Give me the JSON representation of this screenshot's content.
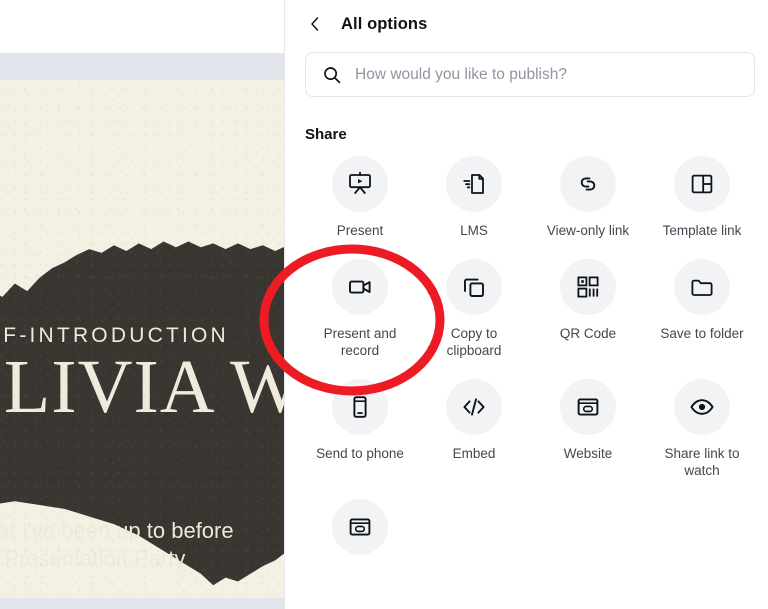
{
  "editor": {
    "slide": {
      "kicker": "SELF-INTRODUCTION",
      "name": "OLIVIA WILSON",
      "subtitle_line1": "What I've been up to before",
      "subtitle_line2": "this Presentation Party",
      "paper_color": "#f4f0e4",
      "ink_color": "#393530"
    }
  },
  "panel": {
    "back_icon": "chevron-left-icon",
    "title": "All options",
    "search": {
      "icon": "search-icon",
      "placeholder": "How would you like to publish?",
      "value": ""
    },
    "section_title": "Share",
    "options": [
      {
        "icon": "present-icon",
        "label": "Present"
      },
      {
        "icon": "lms-document-icon",
        "label": "LMS"
      },
      {
        "icon": "link-icon",
        "label": "View-only link"
      },
      {
        "icon": "template-layout-icon",
        "label": "Template link"
      },
      {
        "icon": "video-camera-icon",
        "label": "Present and record"
      },
      {
        "icon": "copy-icon",
        "label": "Copy to clipboard"
      },
      {
        "icon": "qr-code-icon",
        "label": "QR Code"
      },
      {
        "icon": "folder-icon",
        "label": "Save to folder"
      },
      {
        "icon": "mobile-phone-icon",
        "label": "Send to phone"
      },
      {
        "icon": "code-brackets-icon",
        "label": "Embed"
      },
      {
        "icon": "website-icon",
        "label": "Website"
      },
      {
        "icon": "eye-icon",
        "label": "Share link to watch"
      },
      {
        "icon": "website-icon",
        "label": ""
      }
    ]
  },
  "annotation": {
    "shape": "ellipse",
    "color": "#ED1B24",
    "stroke_width": 9,
    "targets_label": "Present and record"
  }
}
